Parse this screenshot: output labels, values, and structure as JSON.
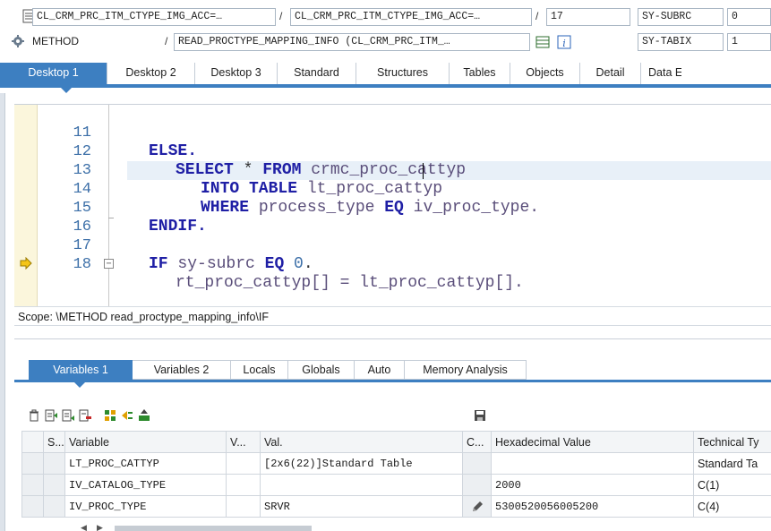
{
  "header": {
    "program": "CL_CRM_PRC_ITM_CTYPE_IMG_ACC=…",
    "include": "CL_CRM_PRC_ITM_CTYPE_IMG_ACC=…",
    "line": "17",
    "event_type": "METHOD",
    "event": "READ_PROCTYPE_MAPPING_INFO (CL_CRM_PRC_ITM_…",
    "sys_fields": [
      {
        "name": "SY-SUBRC",
        "value": "0"
      },
      {
        "name": "SY-TABIX",
        "value": "1"
      }
    ]
  },
  "desktop_tabs": [
    {
      "label": "Desktop 1"
    },
    {
      "label": "Desktop 2"
    },
    {
      "label": "Desktop 3"
    },
    {
      "label": "Standard"
    },
    {
      "label": "Structures"
    },
    {
      "label": "Tables"
    },
    {
      "label": "Objects"
    },
    {
      "label": "Detail"
    },
    {
      "label": "Data Ex"
    }
  ],
  "code_lines": [
    {
      "num": "11"
    },
    {
      "num": "12"
    },
    {
      "num": "13"
    },
    {
      "num": "14"
    },
    {
      "num": "15"
    },
    {
      "num": "16"
    },
    {
      "num": "17"
    },
    {
      "num": "18"
    }
  ],
  "code": {
    "l11_kw": "ELSE.",
    "l12_kw1": "SELECT",
    "l12_star": " * ",
    "l12_kw2": "FROM",
    "l12_id": " crmc_proc_cattyp",
    "l13_kw": "INTO TABLE",
    "l13_id": " lt_proc_cattyp",
    "l14_kw": "WHERE",
    "l14_id": " process_type ",
    "l14_kw2": "EQ",
    "l14_id2": " iv_proc_type.",
    "l15_kw": "ENDIF.",
    "l17_kw": "IF",
    "l17_id": " sy-subrc ",
    "l17_kw2": "EQ",
    "l17_num": " 0",
    "l17_dot": ".",
    "l18_id": "rt_proc_cattyp[] = lt_proc_cattyp[]."
  },
  "scope": "Scope: \\METHOD read_proctype_mapping_info\\IF",
  "variable_tabs": [
    {
      "label": "Variables 1"
    },
    {
      "label": "Variables 2"
    },
    {
      "label": "Locals"
    },
    {
      "label": "Globals"
    },
    {
      "label": "Auto"
    },
    {
      "label": "Memory Analysis"
    }
  ],
  "table": {
    "headers": [
      "S...",
      "Variable",
      "V...",
      "Val.",
      "C...",
      "Hexadecimal Value",
      "Technical Ty"
    ],
    "rows": [
      {
        "variable": "LT_PROC_CATTYP",
        "value": "[2x6(22)]Standard Table",
        "hex": "",
        "type": "Standard Ta"
      },
      {
        "variable": "IV_CATALOG_TYPE",
        "value": "",
        "hex": "2000",
        "type": "C(1)"
      },
      {
        "variable": "IV_PROC_TYPE",
        "value": "SRVR",
        "hex": "5300520056005200",
        "type": "C(4)"
      }
    ]
  },
  "icons": {
    "include": "document-icon",
    "method": "method-gear-icon",
    "edit": "pencil-icon",
    "save": "save-icon",
    "breakpoint": "current-statement-arrow-icon"
  },
  "colors": {
    "accent": "#3d7fc1",
    "keyword": "#1f1fa5",
    "line_number": "#3c6fa8"
  }
}
